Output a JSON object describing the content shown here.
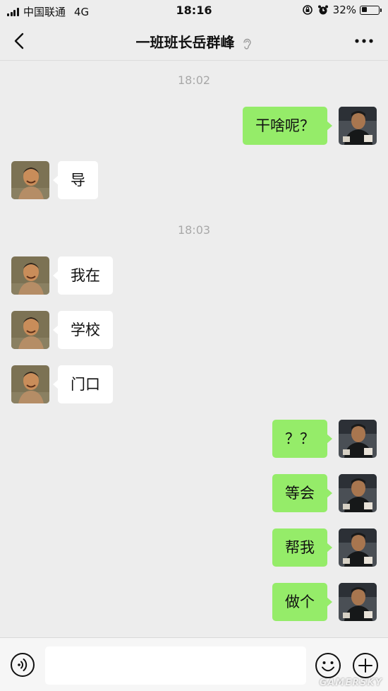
{
  "status_bar": {
    "carrier": "中国联通",
    "network": "4G",
    "time": "18:16",
    "battery": "32%",
    "battery_level": 0.32
  },
  "header": {
    "title": "一班班长岳群峰",
    "back_icon": "chevron-left-icon",
    "more_icon": "more-dots-icon",
    "mute_icon": "ear-icon"
  },
  "chat": {
    "timestamps": [
      "18:02",
      "18:03"
    ],
    "messages": [
      {
        "side": "out",
        "text": "干啥呢？"
      },
      {
        "side": "in",
        "text": "导"
      },
      {
        "side": "in",
        "text": "我在"
      },
      {
        "side": "in",
        "text": "学校"
      },
      {
        "side": "in",
        "text": "门口"
      },
      {
        "side": "out",
        "text": "？？"
      },
      {
        "side": "out",
        "text": "等会"
      },
      {
        "side": "out",
        "text": "帮我"
      },
      {
        "side": "out",
        "text": "做个"
      },
      {
        "side": "out",
        "text": ""
      }
    ]
  },
  "input_bar": {
    "voice_icon": "voice-icon",
    "emoji_icon": "emoji-icon",
    "plus_icon": "plus-icon",
    "placeholder": ""
  },
  "watermark": "GAMERSKY",
  "colors": {
    "background": "#ededed",
    "bubble_out": "#95ec69",
    "bubble_in": "#ffffff",
    "timestamp": "#a8a8a8"
  }
}
